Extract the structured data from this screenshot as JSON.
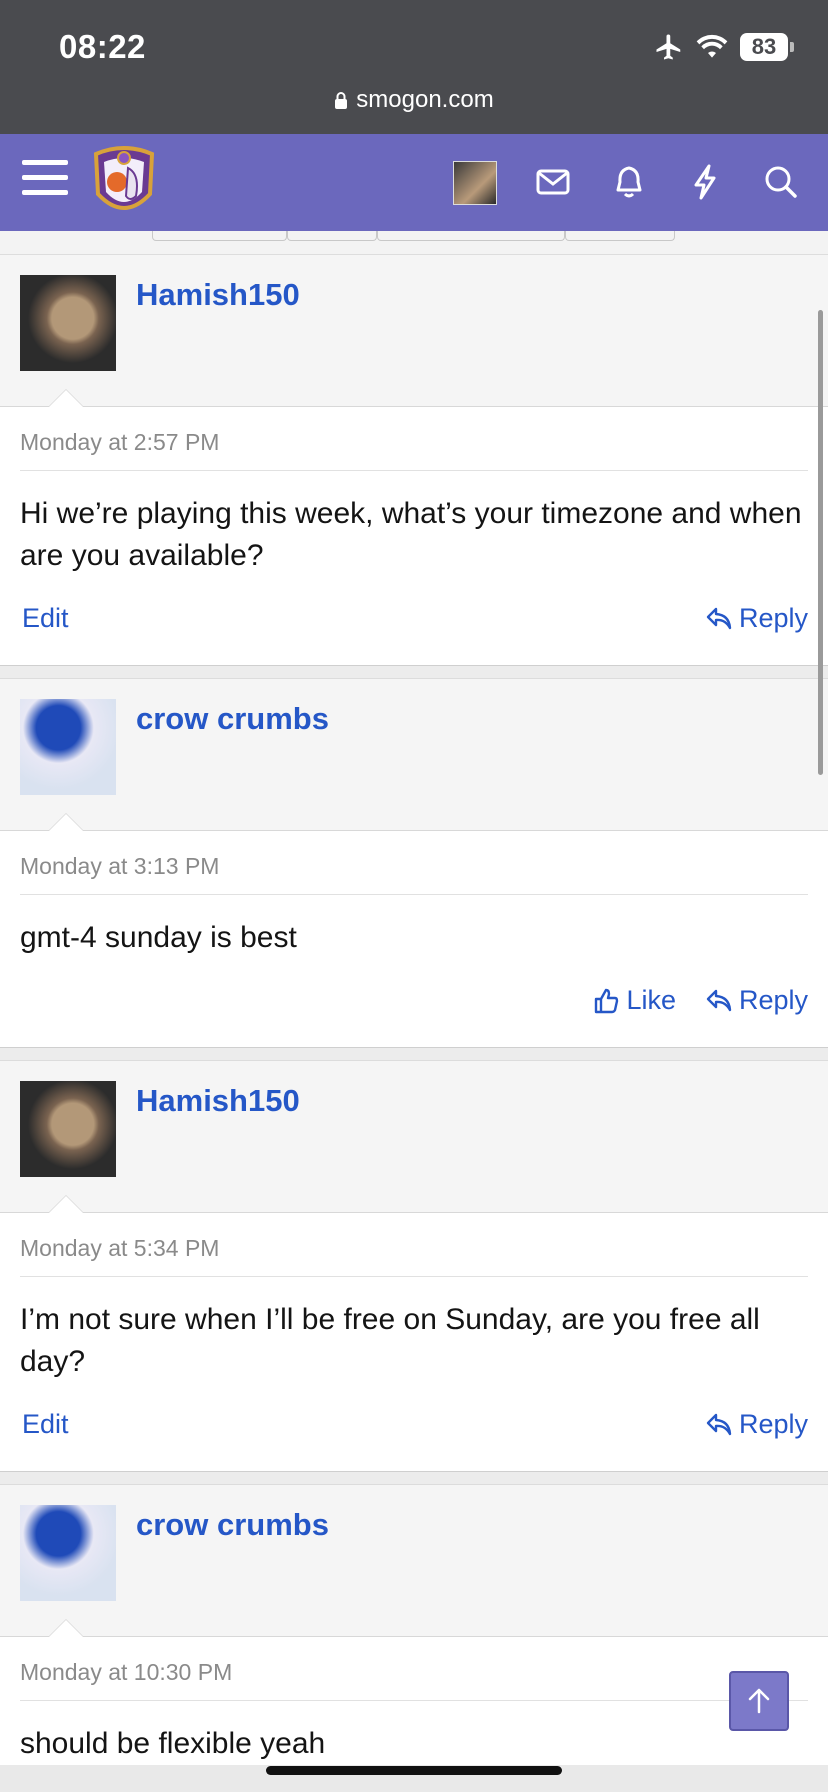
{
  "status_bar": {
    "time": "08:22",
    "battery": "83",
    "url": "smogon.com"
  },
  "nav": {
    "icons": [
      "menu-icon",
      "site-logo",
      "user-avatar",
      "mail-icon",
      "bell-icon",
      "bolt-icon",
      "search-icon"
    ],
    "accent": "#6b68bd"
  },
  "posts": [
    {
      "author": "Hamish150",
      "date": "Monday at 2:57 PM",
      "text": "Hi we’re playing this week, what’s your timezone and when are you available?",
      "left_action": "Edit",
      "reply": "Reply"
    },
    {
      "author": "crow crumbs",
      "date": "Monday at 3:13 PM",
      "text": "gmt-4 sunday is best",
      "like": "Like",
      "reply": "Reply"
    },
    {
      "author": "Hamish150",
      "date": "Monday at 5:34 PM",
      "text": "I’m not sure when I’ll be free on Sunday, are you free all day?",
      "left_action": "Edit",
      "reply": "Reply"
    },
    {
      "author": "crow crumbs",
      "date": "Monday at 10:30 PM",
      "text": "should be flexible yeah"
    }
  ],
  "colors": {
    "link": "#2557c7",
    "date": "#8a8a8a"
  }
}
